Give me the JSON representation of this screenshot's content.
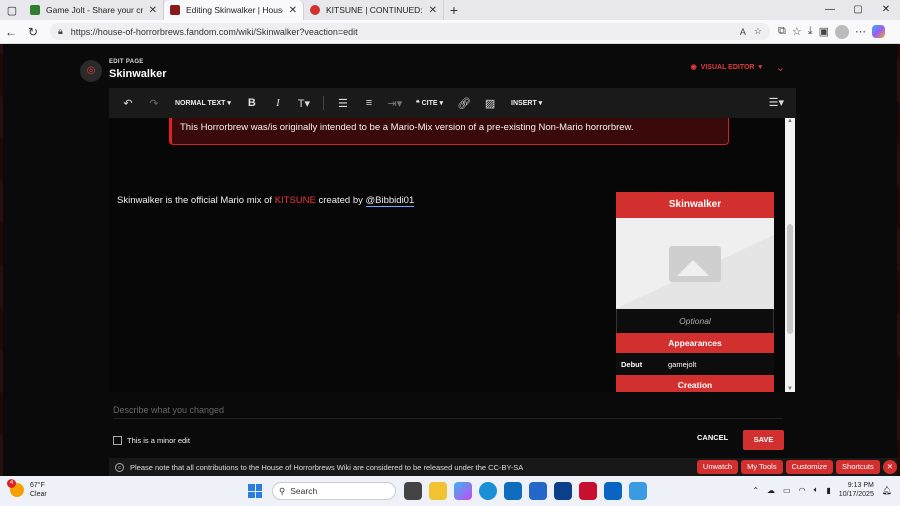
{
  "browser": {
    "tabs": [
      {
        "title": "Game Jolt - Share your creations",
        "favicon_color": "#2f7f2f",
        "active": false
      },
      {
        "title": "Editing Skinwalker | House of Hor",
        "favicon_color": "#8b1a1a",
        "active": true
      },
      {
        "title": "KITSUNE | CONTINUED: The Soni",
        "favicon_color": "#d22f2f",
        "active": false
      }
    ],
    "url": "https://house-of-horrorbrews.fandom.com/wiki/Skinwalker?veaction=edit"
  },
  "editor": {
    "edit_label": "EDIT PAGE",
    "page_title": "Skinwalker",
    "visual_editor_label": "VISUAL EDITOR",
    "toolbar": {
      "paragraph": "NORMAL TEXT",
      "cite": "CITE",
      "insert": "INSERT"
    },
    "notice": "This Horrorbrew was/is originally intended to be a Mario-Mix version of a pre-existing Non-Mario horrorbrew.",
    "body": {
      "before": "Skinwalker is the official Mario mix of ",
      "link": "KITSUNE",
      "after": " created by ",
      "underlined": "@Bibbidi01"
    },
    "infobox": {
      "title": "Skinwalker",
      "caption": "Optional",
      "sections": [
        {
          "title": "Appearances",
          "rows": [
            {
              "key": "Debut",
              "value": "gamejolt"
            }
          ]
        },
        {
          "title": "Creation"
        }
      ]
    },
    "summary_placeholder": "Describe what you changed",
    "minor_edit_label": "This is a minor edit",
    "cancel_label": "CANCEL",
    "save_label": "SAVE",
    "license_notice": "Please note that all contributions to the House of Horrorbrews Wiki are considered to be released under the CC-BY-SA",
    "mini_tools": [
      "Unwatch",
      "My Tools",
      "Customize",
      "Shortcuts"
    ]
  },
  "taskbar": {
    "temperature": "67°F",
    "condition": "Clear",
    "weather_badge": "4",
    "search_label": "Search",
    "time": "9:13 PM",
    "date": "10/17/2025"
  },
  "colors": {
    "accent": "#d22f2f",
    "link": "#e33333",
    "taskbar_bg": "#eef2f8"
  }
}
